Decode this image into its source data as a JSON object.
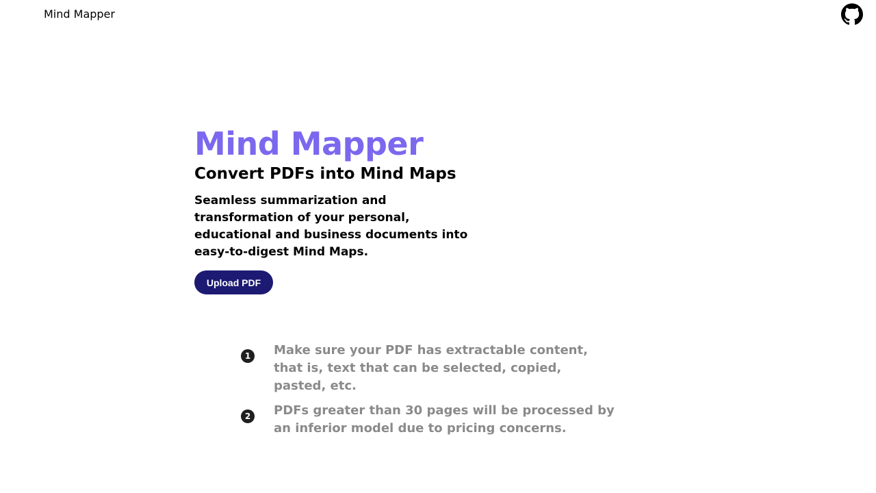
{
  "header": {
    "brand": "Mind Mapper",
    "github_icon": "github-icon"
  },
  "hero": {
    "title": "Mind Mapper",
    "subtitle": "Convert PDFs into Mind Maps",
    "description": "Seamless summarization and transformation of your personal, educational and business documents into easy-to-digest Mind Maps.",
    "upload_label": "Upload PDF"
  },
  "tips": [
    {
      "number": "1",
      "text": "Make sure your PDF has extractable content, that is, text that can be selected, copied, pasted, etc."
    },
    {
      "number": "2",
      "text": "PDFs greater than 30 pages will be processed by an inferior model due to pricing concerns."
    }
  ],
  "colors": {
    "accent": "#7b68ee",
    "button": "#1c1a72",
    "tip_text": "#8a8a8a"
  }
}
